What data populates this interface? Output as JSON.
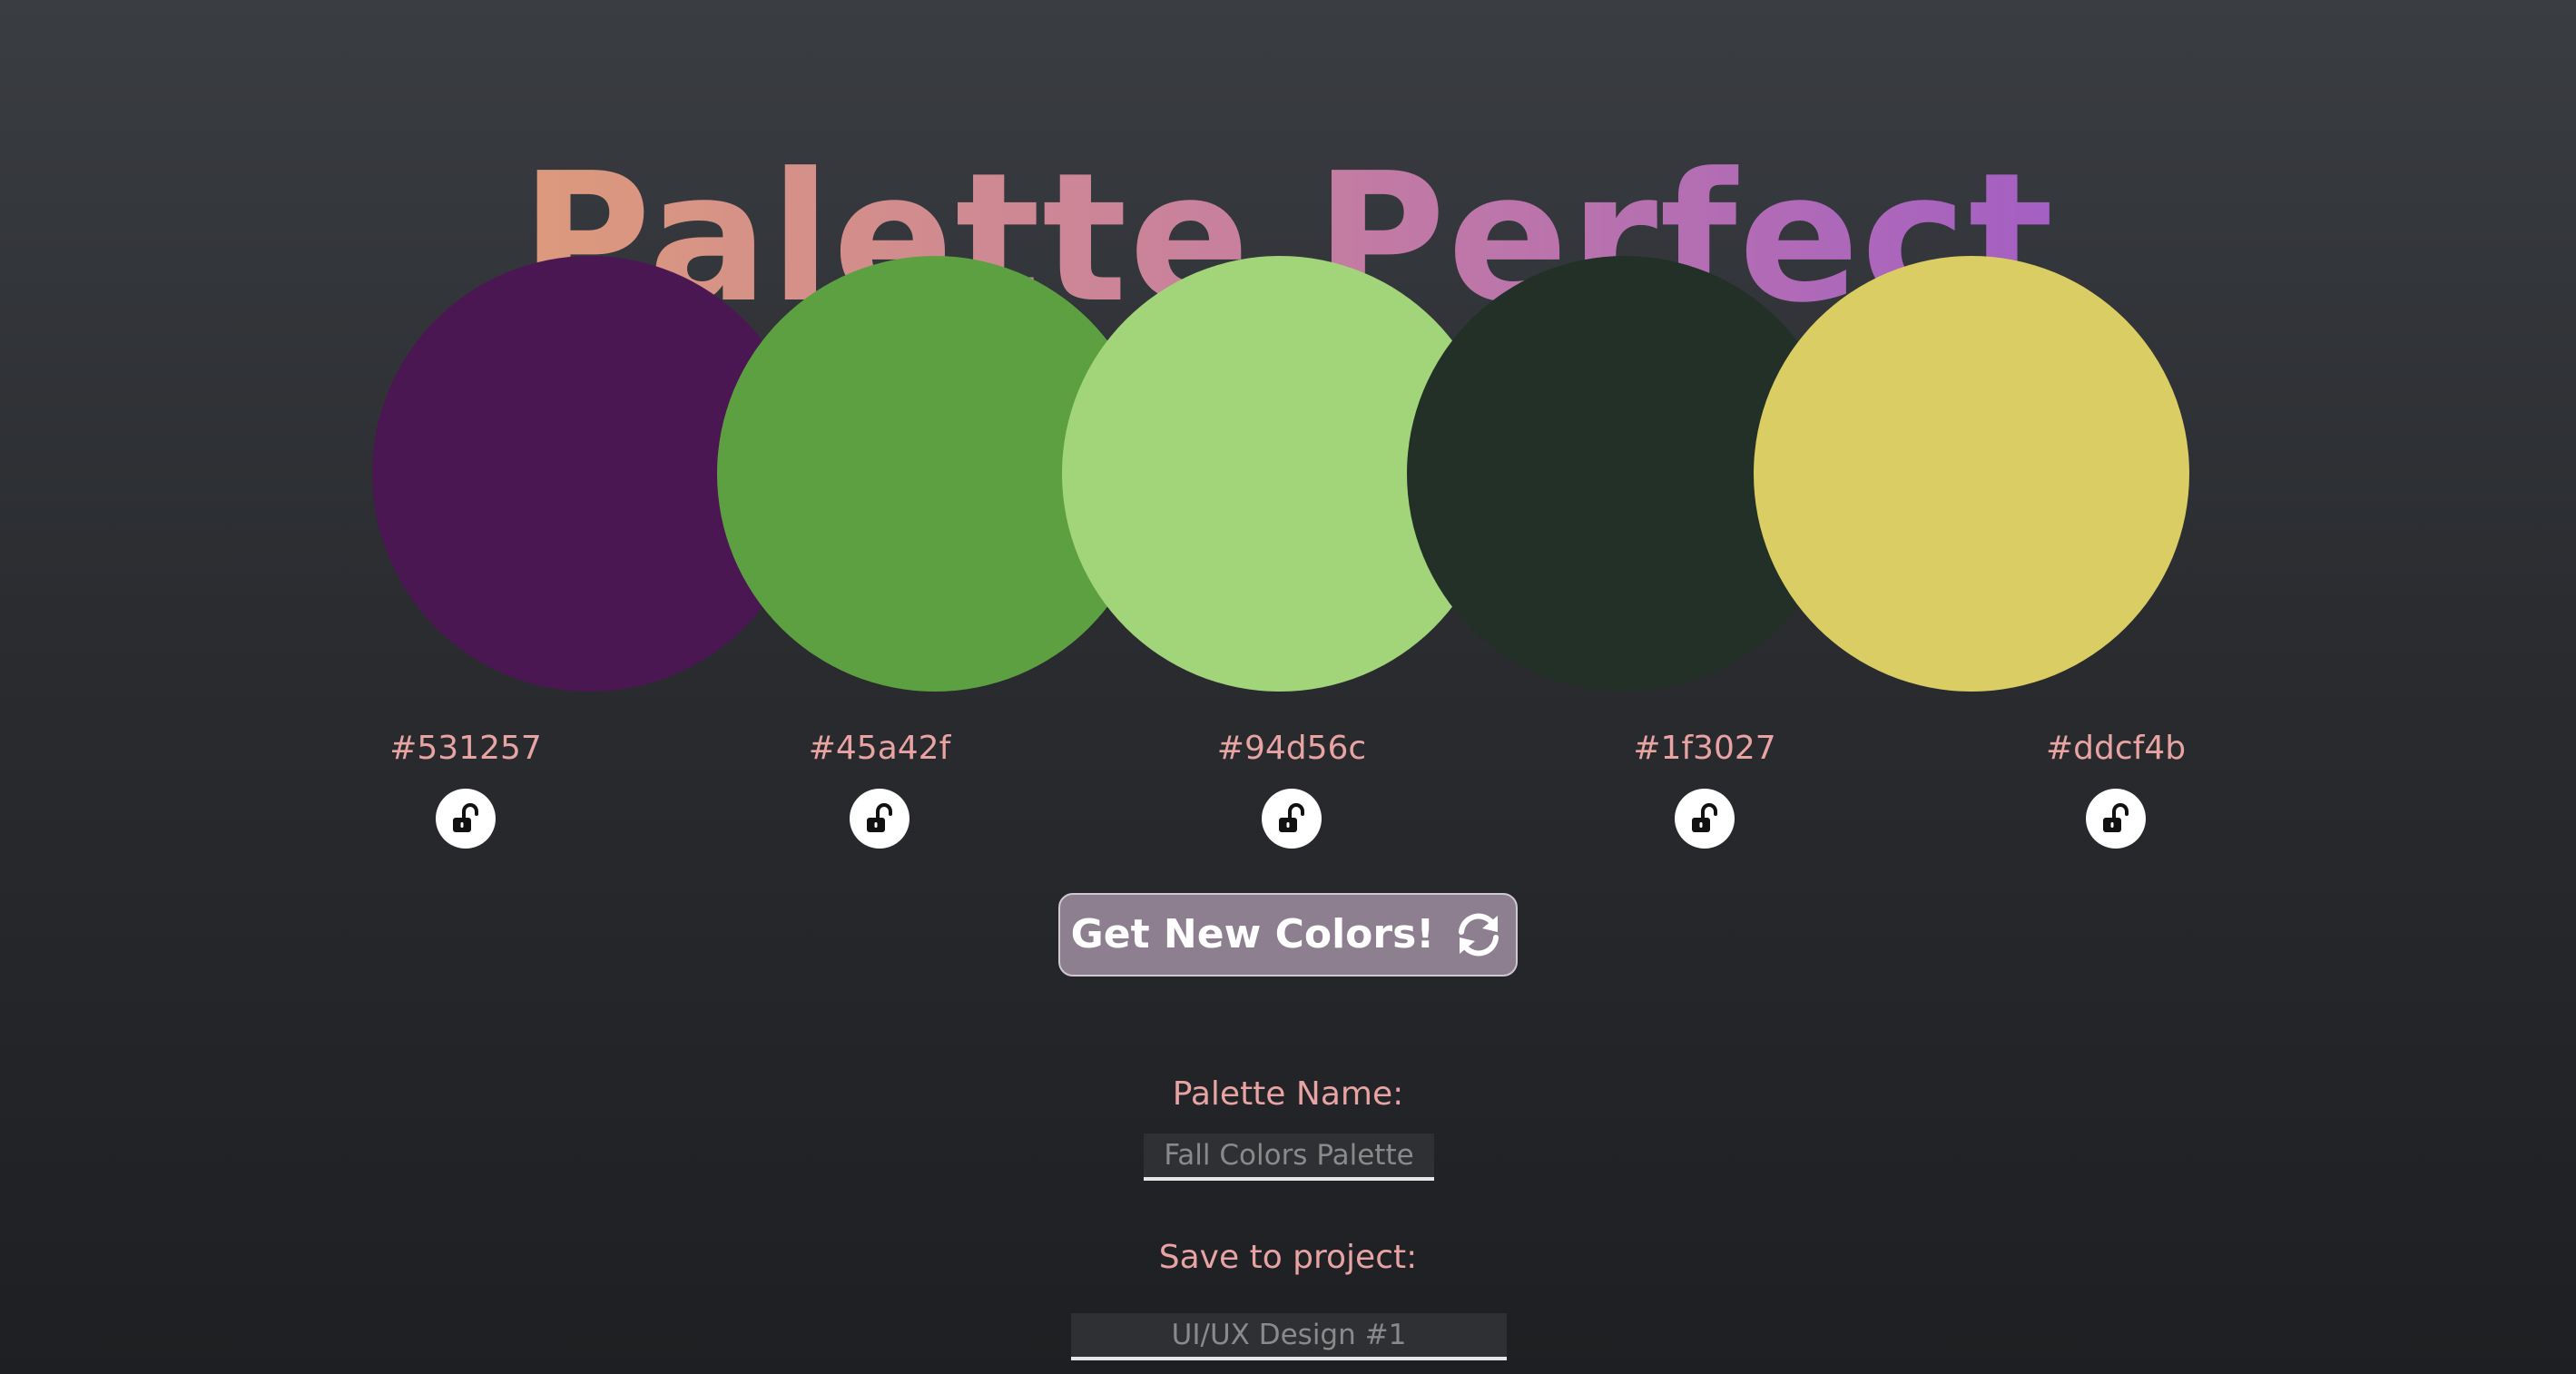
{
  "app": {
    "title": "Palette Perfect"
  },
  "palette": {
    "swatches": [
      {
        "hex": "#531257",
        "color": "#4b1752",
        "lock_icon": "unlocked-padlock-icon",
        "locked": false
      },
      {
        "hex": "#45a42f",
        "color": "#5da041",
        "lock_icon": "unlocked-padlock-icon",
        "locked": false
      },
      {
        "hex": "#94d56c",
        "color": "#a2d47a",
        "lock_icon": "unlocked-padlock-icon",
        "locked": false
      },
      {
        "hex": "#1f3027",
        "color": "#223028",
        "lock_icon": "unlocked-padlock-icon",
        "locked": false
      },
      {
        "hex": "#ddcf4b",
        "color": "#dacd63",
        "lock_icon": "unlocked-padlock-icon",
        "locked": false
      }
    ]
  },
  "actions": {
    "new_colors_label": "Get New Colors!",
    "new_colors_icon": "refresh-icon"
  },
  "form": {
    "palette_name_label": "Palette Name:",
    "palette_name_placeholder": "Fall Colors Palette",
    "project_label": "Save to project:",
    "project_placeholder": "UI/UX Design #1"
  },
  "colors": {
    "label_text": "#e8a3a3",
    "title_gradient": [
      "#dd9a7c",
      "#c67ea0",
      "#a45fc3"
    ],
    "button_bg": "#8d7f8f"
  }
}
